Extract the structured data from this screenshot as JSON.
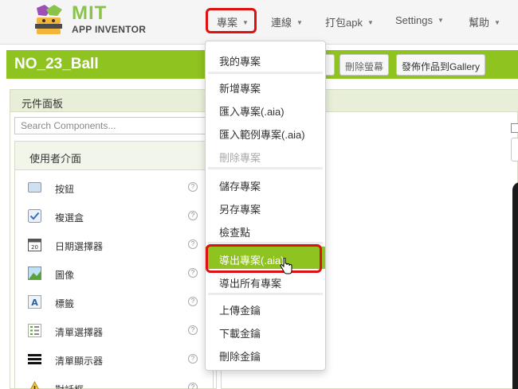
{
  "app": {
    "logo_title": "MIT",
    "logo_subtitle": "APP INVENTOR"
  },
  "nav": {
    "items": [
      {
        "label": "專案",
        "caret": "▼"
      },
      {
        "label": "連線",
        "caret": "▼"
      },
      {
        "label": "打包apk",
        "caret": "▼"
      },
      {
        "label": "Settings",
        "caret": "▼"
      },
      {
        "label": "幫助",
        "caret": "▼"
      }
    ]
  },
  "project": {
    "title": "NO_23_Ball",
    "delete_screen_label": "刪除螢幕",
    "publish_label": "發佈作品到Gallery"
  },
  "palette": {
    "title": "元件面板",
    "search_placeholder": "Search Components...",
    "group_title": "使用者介面",
    "components": [
      {
        "label": "按鈕",
        "icon": "button-icon",
        "help": "?"
      },
      {
        "label": "複選盒",
        "icon": "checkbox-icon",
        "help": "?"
      },
      {
        "label": "日期選擇器",
        "icon": "date-picker-icon",
        "help": "?"
      },
      {
        "label": "圖像",
        "icon": "image-icon",
        "help": "?"
      },
      {
        "label": "標籤",
        "icon": "label-icon",
        "help": "?"
      },
      {
        "label": "清單選擇器",
        "icon": "list-picker-icon",
        "help": "?"
      },
      {
        "label": "清單顯示器",
        "icon": "list-view-icon",
        "help": "?"
      },
      {
        "label": "對話框",
        "icon": "notifier-icon",
        "help": "?"
      }
    ]
  },
  "menu": {
    "items": [
      {
        "label": "我的專案",
        "state": "normal"
      },
      {
        "label": "新增專案",
        "state": "normal"
      },
      {
        "label": "匯入專案(.aia)",
        "state": "normal"
      },
      {
        "label": "匯入範例專案(.aia)",
        "state": "normal"
      },
      {
        "label": "刪除專案",
        "state": "disabled"
      },
      {
        "label": "儲存專案",
        "state": "normal"
      },
      {
        "label": "另存專案",
        "state": "normal"
      },
      {
        "label": "檢查點",
        "state": "normal"
      },
      {
        "label": "導出專案(.aia)",
        "state": "highlighted"
      },
      {
        "label": "導出所有專案",
        "state": "normal"
      },
      {
        "label": "上傳金鑰",
        "state": "normal"
      },
      {
        "label": "下載金鑰",
        "state": "normal"
      },
      {
        "label": "刪除金鑰",
        "state": "normal"
      }
    ]
  },
  "colors": {
    "accent_green": "#8fc31f",
    "highlight_red": "#e01010",
    "logo_green": "#8bc34a"
  }
}
